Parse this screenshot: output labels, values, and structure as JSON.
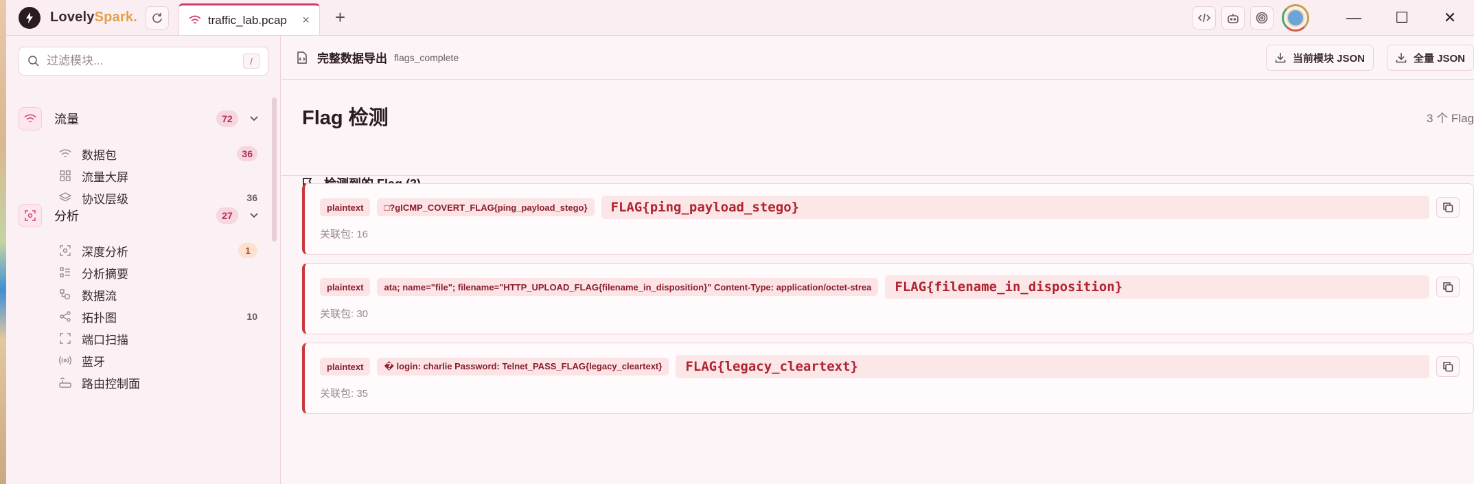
{
  "app": {
    "brand_main": "Lovely",
    "brand_accent": "Spark.",
    "tab_title": "traffic_lab.pcap",
    "tab_close": "×",
    "new_tab": "+",
    "icons": [
      "code-icon",
      "robot-icon",
      "target-icon",
      "avatar"
    ],
    "window_controls": {
      "minimize": "—",
      "maximize": "☐",
      "close": "✕"
    }
  },
  "sidebar": {
    "filter_placeholder": "过滤模块...",
    "filter_shortcut": "/",
    "groups": [
      {
        "label": "流量",
        "count": "72",
        "icon": "wifi-icon",
        "items": [
          {
            "label": "数据包",
            "count": "36",
            "icon": "wifi-icon",
            "style": "pill"
          },
          {
            "label": "流量大屏",
            "count": "",
            "icon": "grid-icon",
            "style": ""
          },
          {
            "label": "协议层级",
            "count": "36",
            "icon": "layers-icon",
            "style": "plain"
          }
        ]
      },
      {
        "label": "分析",
        "count": "27",
        "icon": "scan-icon",
        "items": [
          {
            "label": "深度分析",
            "count": "1",
            "icon": "scan-icon",
            "style": "orange"
          },
          {
            "label": "分析摘要",
            "count": "",
            "icon": "list-icon",
            "style": ""
          },
          {
            "label": "数据流",
            "count": "",
            "icon": "flow-icon",
            "style": ""
          },
          {
            "label": "拓扑图",
            "count": "10",
            "icon": "share-icon",
            "style": "plain"
          },
          {
            "label": "端口扫描",
            "count": "",
            "icon": "frame-icon",
            "style": ""
          },
          {
            "label": "蓝牙",
            "count": "",
            "icon": "broadcast-icon",
            "style": ""
          },
          {
            "label": "路由控制面",
            "count": "",
            "icon": "router-icon",
            "style": ""
          }
        ]
      }
    ]
  },
  "export_bar": {
    "title": "完整数据导出",
    "subtitle": "flags_complete",
    "btn_current": "当前模块 JSON",
    "btn_all": "全量 JSON"
  },
  "section": {
    "title": "Flag 检测",
    "count_text": "3 个 Flag",
    "subheading": "检测到的 Flag (3)"
  },
  "flags": [
    {
      "type": "plaintext",
      "context": "□?gICMP_COVERT_FLAG{ping_payload_stego}",
      "value": "FLAG{ping_payload_stego}",
      "related": "关联包: 16"
    },
    {
      "type": "plaintext",
      "context": "ata; name=\"file\"; filename=\"HTTP_UPLOAD_FLAG{filename_in_disposition}\" Content-Type: application/octet-strea",
      "value": "FLAG{filename_in_disposition}",
      "related": "关联包: 30"
    },
    {
      "type": "plaintext",
      "context": "� login: charlie Password: Telnet_PASS_FLAG{legacy_cleartext}",
      "value": "FLAG{legacy_cleartext}",
      "related": "关联包: 35"
    }
  ],
  "colors": {
    "accent": "#d23b6a",
    "flag_red": "#b0242e",
    "card_border": "#c9363e"
  }
}
